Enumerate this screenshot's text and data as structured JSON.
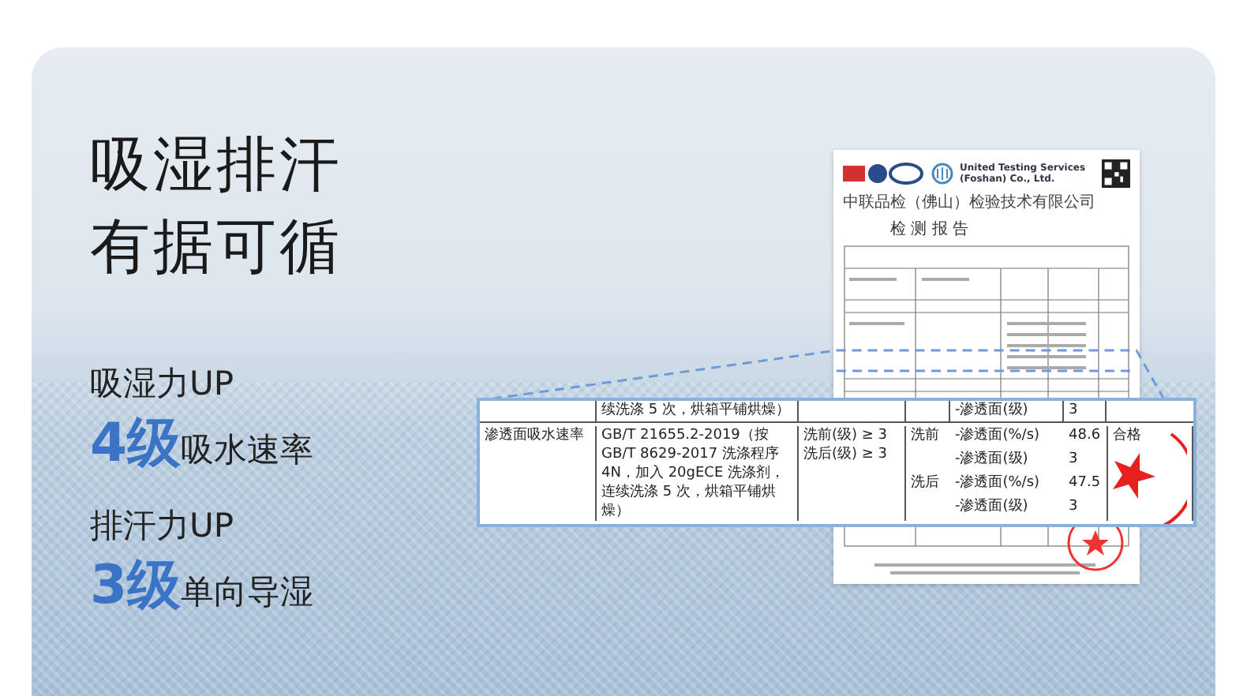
{
  "headline": [
    "吸湿排汗",
    "有据可循"
  ],
  "features": [
    {
      "title": "吸湿力UP",
      "grade": "4级",
      "desc": "吸水速率"
    },
    {
      "title": "排汗力UP",
      "grade": "3级",
      "desc": "单向导湿"
    }
  ],
  "report": {
    "company_cn": "中联品检（佛山）检验技术有限公司",
    "company_en": "United Testing Services (Foshan) Co., Ltd.",
    "title": "检 测 报 告"
  },
  "magnified_table": {
    "top_row": {
      "standard": "续洗涤 5 次，烘箱平铺烘燥）",
      "metric": "-渗透面(级)",
      "value": "3"
    },
    "row": {
      "item": "渗透面吸水速率",
      "standard": "GB/T 21655.2-2019（按 GB/T 8629-2017 洗涤程序 4N，加入 20gECE 洗涤剂，连续洗涤 5 次，烘箱平铺烘燥）",
      "requirements": [
        "洗前(级) ≥ 3",
        "洗后(级) ≥ 3"
      ],
      "results": [
        {
          "stage": "洗前",
          "metric": "-渗透面(%/s)",
          "value": "48.6"
        },
        {
          "metric": "-渗透面(级)",
          "value": "3"
        },
        {
          "stage": "洗后",
          "metric": "-渗透面(%/s)",
          "value": "47.5"
        },
        {
          "metric": "-渗透面(级)",
          "value": "3"
        }
      ],
      "verdict": "合格"
    }
  }
}
